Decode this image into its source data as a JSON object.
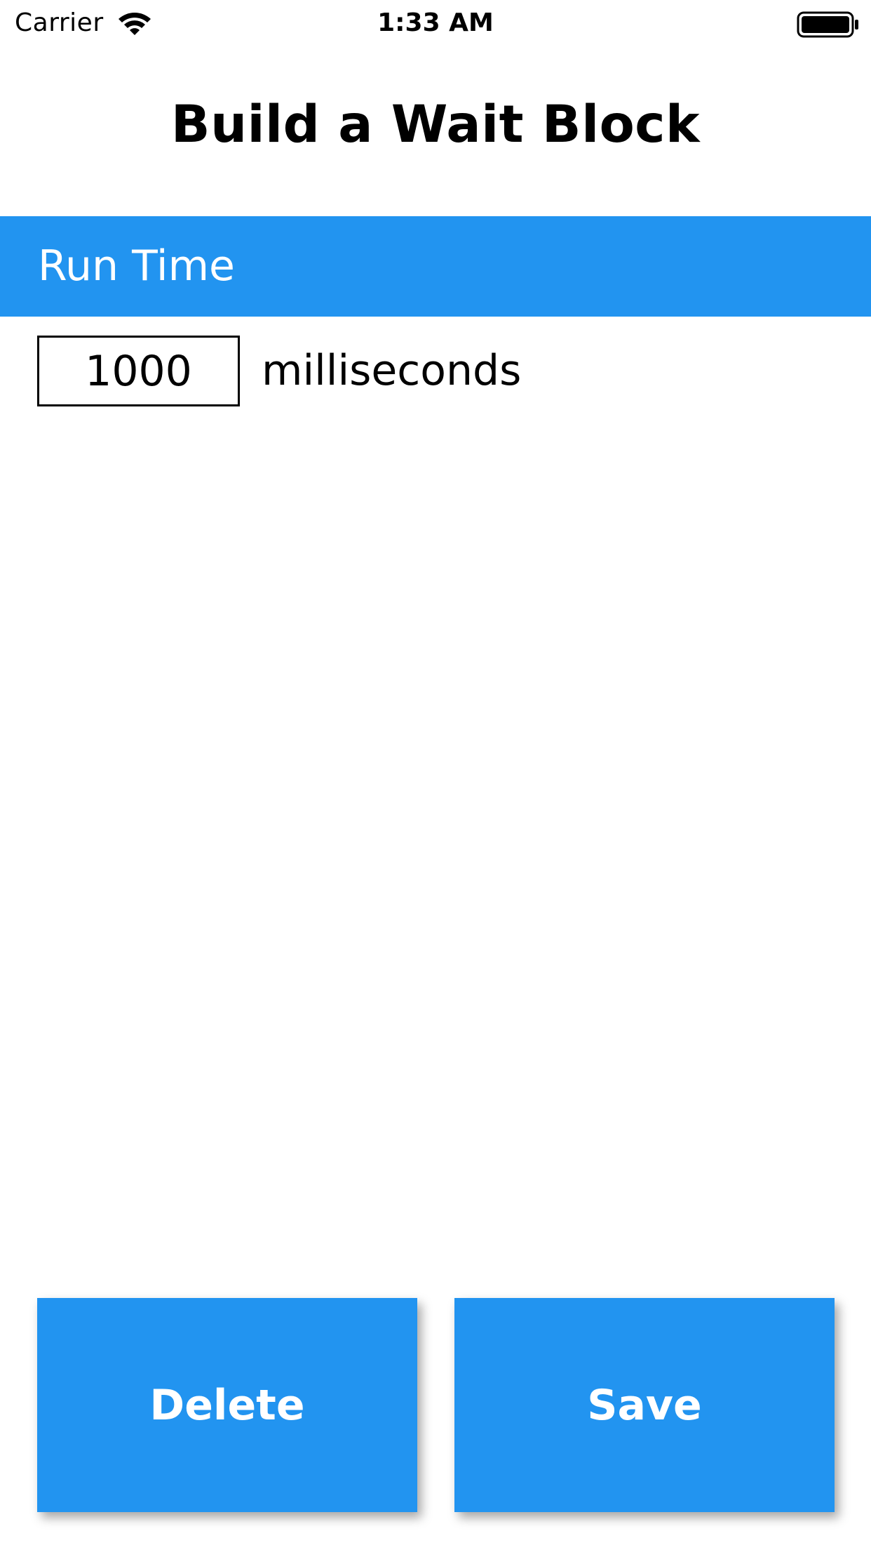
{
  "status_bar": {
    "carrier": "Carrier",
    "time": "1:33 AM",
    "icons": [
      "wifi-icon",
      "battery-icon"
    ]
  },
  "header": {
    "title": "Build a Wait Block"
  },
  "run_time_section": {
    "header_label": "Run Time",
    "duration_value": "1000",
    "unit_label": "milliseconds"
  },
  "actions": {
    "delete_label": "Delete",
    "save_label": "Save"
  },
  "colors": {
    "accent": "#2294F0",
    "background": "#FFFFFF",
    "text": "#000000",
    "button_text": "#FFFFFF"
  }
}
